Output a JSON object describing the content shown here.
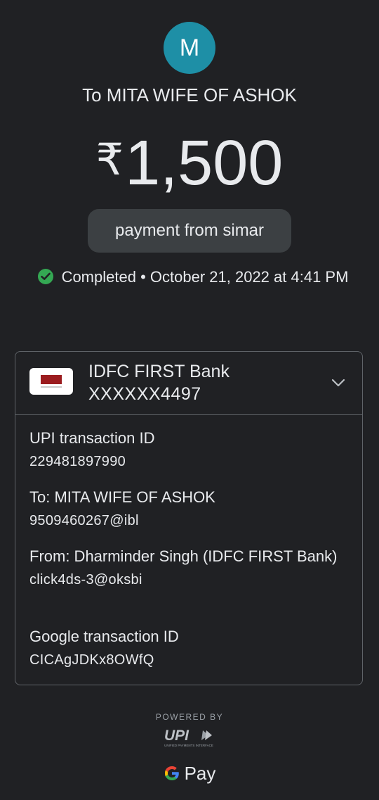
{
  "payee": {
    "avatar_initial": "M",
    "avatar_color": "#1e8fa6",
    "title": "To MITA WIFE OF ASHOK"
  },
  "payment": {
    "currency_symbol": "₹",
    "amount": "1,500",
    "note": "payment from simar",
    "status": "Completed",
    "separator": "•",
    "datetime": "October 21, 2022 at 4:41 PM",
    "status_color": "#34a853"
  },
  "bank": {
    "name": "IDFC FIRST Bank",
    "account": "XXXXXX4497",
    "logo_icon": "idfc-bank-logo",
    "expand_icon": "chevron-down-icon"
  },
  "details": [
    {
      "label": "UPI transaction ID",
      "value": "229481897990"
    },
    {
      "label": "To: MITA WIFE OF ASHOK",
      "value": "9509460267@ibl"
    },
    {
      "label": "From: Dharminder  Singh (IDFC FIRST Bank)",
      "value": "click4ds-3@oksbi"
    },
    {
      "label": "Google transaction ID",
      "value": "CICAgJDKx8OWfQ"
    }
  ],
  "footer": {
    "powered_by": "POWERED BY",
    "upi_logo": "UPI",
    "upi_tagline": "UNIFIED PAYMENTS INTERFACE",
    "brand": "Pay"
  }
}
